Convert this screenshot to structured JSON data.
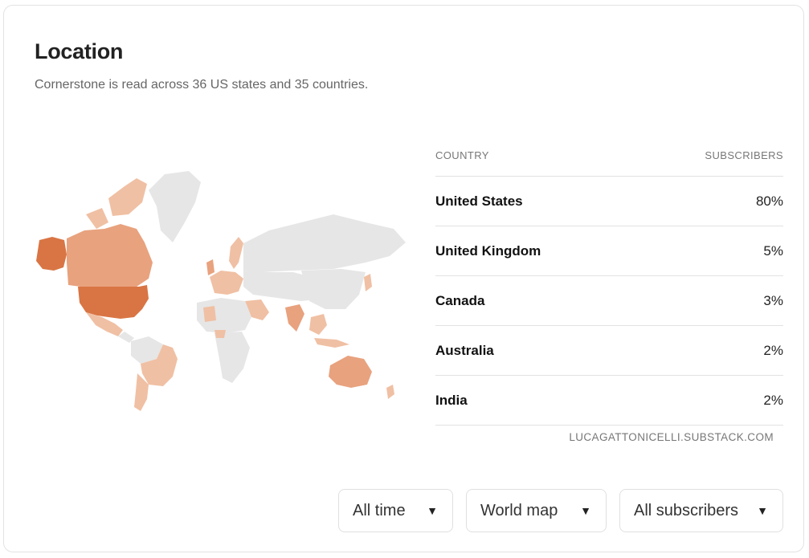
{
  "header": {
    "title": "Location",
    "subtitle": "Cornerstone is read across 36 US states and 35 countries."
  },
  "table": {
    "col_country": "COUNTRY",
    "col_subscribers": "SUBSCRIBERS",
    "rows": [
      {
        "country": "United States",
        "value": "80%"
      },
      {
        "country": "United Kingdom",
        "value": "5%"
      },
      {
        "country": "Canada",
        "value": "3%"
      },
      {
        "country": "Australia",
        "value": "2%"
      },
      {
        "country": "India",
        "value": "2%"
      }
    ],
    "source": "LUCAGATTONICELLI.SUBSTACK.COM"
  },
  "map": {
    "colors": {
      "base": "#e6e6e6",
      "highest": "#d97544",
      "mid": "#e8a27e",
      "low": "#f0c0a4"
    }
  },
  "controls": {
    "period": "All time",
    "view": "World map",
    "audience": "All subscribers",
    "caret_icon": "triangle-down-icon"
  }
}
